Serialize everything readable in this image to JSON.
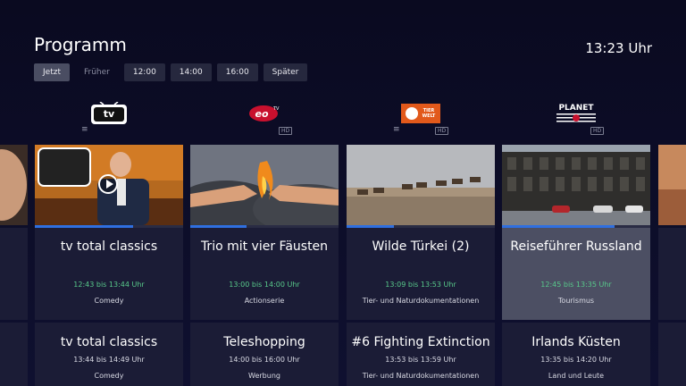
{
  "header": {
    "title": "Programm",
    "clock": "13:23 Uhr"
  },
  "filters": [
    {
      "label": "Jetzt",
      "state": "active"
    },
    {
      "label": "Früher",
      "state": "dim"
    },
    {
      "label": "12:00",
      "state": "normal"
    },
    {
      "label": "14:00",
      "state": "normal"
    },
    {
      "label": "16:00",
      "state": "normal"
    },
    {
      "label": "Später",
      "state": "normal"
    }
  ],
  "channels": [
    {
      "logo_text": "tv total",
      "logo_icon": "tv-total-logo",
      "badge_recording": "≡",
      "now": {
        "show": "tv total classics",
        "time": "12:43 bis 13:44 Uhr",
        "genre": "Comedy",
        "progress": 0.66
      },
      "next": {
        "show": "tv total classics",
        "time": "13:44 bis 14:49 Uhr",
        "genre": "Comedy"
      }
    },
    {
      "logo_text": "eo TV",
      "logo_icon": "eotv-logo",
      "badge_hd": "HD",
      "now": {
        "show": "Trio mit vier Fäusten",
        "time": "13:00 bis 14:00 Uhr",
        "genre": "Actionserie",
        "progress": 0.38
      },
      "next": {
        "show": "Teleshopping",
        "time": "14:00 bis 16:00 Uhr",
        "genre": "Werbung"
      }
    },
    {
      "logo_text": "TIER WELT",
      "logo_icon": "tierwelt-logo",
      "badge_recording": "≡",
      "badge_hd": "HD",
      "now": {
        "show": "Wilde Türkei (2)",
        "time": "13:09 bis 13:53 Uhr",
        "genre": "Tier- und Naturdokumentationen",
        "progress": 0.32
      },
      "next": {
        "show": "#6 Fighting Extinction",
        "time": "13:53 bis 13:59 Uhr",
        "genre": "Tier- und Naturdokumentationen"
      }
    },
    {
      "logo_text": "PLANET",
      "logo_icon": "planet-logo",
      "badge_hd": "HD",
      "now": {
        "show": "Reiseführer Russland",
        "time": "12:45 bis 13:35 Uhr",
        "genre": "Tourismus",
        "progress": 0.76
      },
      "next": {
        "show": "Irlands Küsten",
        "time": "13:35 bis 14:20 Uhr",
        "genre": "Land und Leute"
      }
    }
  ],
  "colors": {
    "accent": "#2f6fe0",
    "time_now": "#58c98a",
    "background": "#0b0b22",
    "card": "#1b1c36",
    "card_focus": "#4c4f63"
  }
}
